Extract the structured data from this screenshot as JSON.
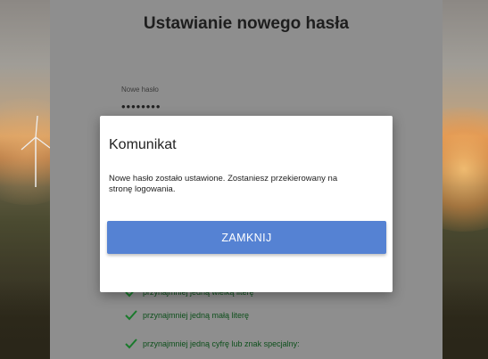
{
  "page": {
    "title": "Ustawianie nowego hasła",
    "password_label": "Nowe hasło",
    "password_value": "••••••••",
    "requirements": [
      "przynajmniej jedną wielką literę",
      "przynajmniej jedną małą literę",
      "przynajmniej jedną cyfrę lub znak specjalny:"
    ]
  },
  "dialog": {
    "title": "Komunikat",
    "message": "Nowe hasło zostało ustawione. Zostaniesz przekierowany na stronę logowania.",
    "close_label": "ZAMKNIJ"
  },
  "colors": {
    "button": "#5582d3",
    "check": "#1a7a2c"
  },
  "icons": {
    "requirement": "checkmark-icon"
  }
}
